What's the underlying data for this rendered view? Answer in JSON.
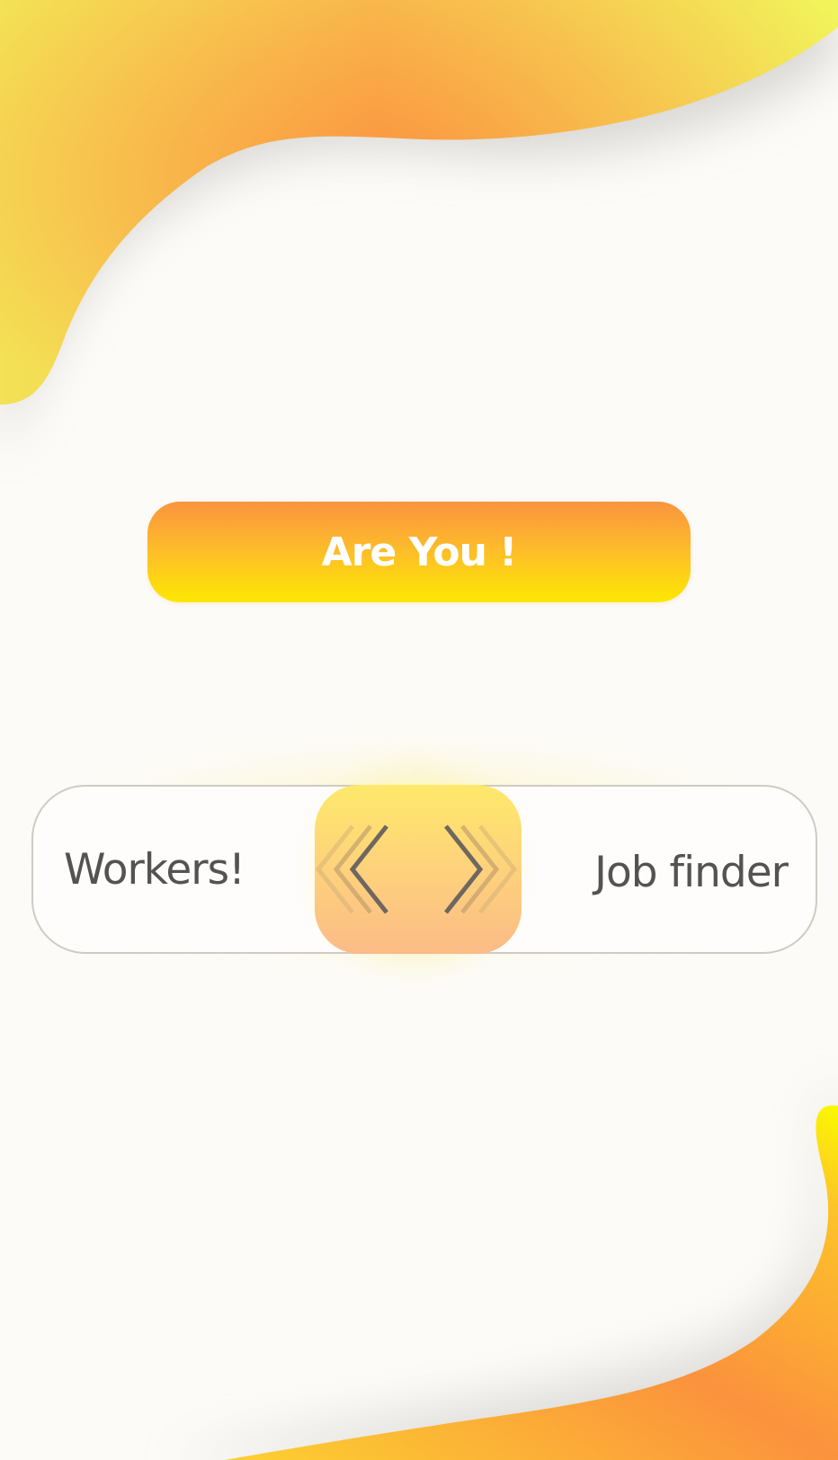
{
  "screen": {
    "title": "Are You !"
  },
  "slider": {
    "left_option": "Workers!",
    "right_option": "Job finder",
    "handle_icon_left": "chevrons-left-icon",
    "handle_icon_right": "chevrons-right-icon"
  },
  "colors": {
    "background": "#fcfbf8",
    "accent_orange": "#fa9440",
    "accent_yellow": "#fde803",
    "text": "#555350"
  }
}
